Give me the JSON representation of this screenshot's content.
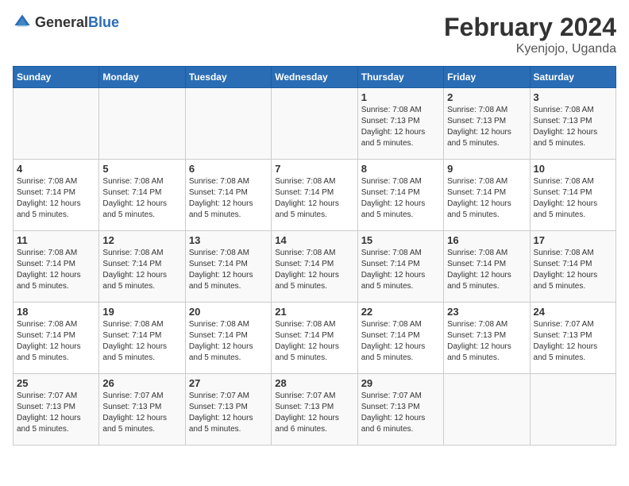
{
  "logo": {
    "general": "General",
    "blue": "Blue"
  },
  "title": "February 2024",
  "location": "Kyenjojo, Uganda",
  "days_of_week": [
    "Sunday",
    "Monday",
    "Tuesday",
    "Wednesday",
    "Thursday",
    "Friday",
    "Saturday"
  ],
  "weeks": [
    [
      {
        "day": "",
        "info": ""
      },
      {
        "day": "",
        "info": ""
      },
      {
        "day": "",
        "info": ""
      },
      {
        "day": "",
        "info": ""
      },
      {
        "day": "1",
        "info": "Sunrise: 7:08 AM\nSunset: 7:13 PM\nDaylight: 12 hours\nand 5 minutes."
      },
      {
        "day": "2",
        "info": "Sunrise: 7:08 AM\nSunset: 7:13 PM\nDaylight: 12 hours\nand 5 minutes."
      },
      {
        "day": "3",
        "info": "Sunrise: 7:08 AM\nSunset: 7:13 PM\nDaylight: 12 hours\nand 5 minutes."
      }
    ],
    [
      {
        "day": "4",
        "info": "Sunrise: 7:08 AM\nSunset: 7:14 PM\nDaylight: 12 hours\nand 5 minutes."
      },
      {
        "day": "5",
        "info": "Sunrise: 7:08 AM\nSunset: 7:14 PM\nDaylight: 12 hours\nand 5 minutes."
      },
      {
        "day": "6",
        "info": "Sunrise: 7:08 AM\nSunset: 7:14 PM\nDaylight: 12 hours\nand 5 minutes."
      },
      {
        "day": "7",
        "info": "Sunrise: 7:08 AM\nSunset: 7:14 PM\nDaylight: 12 hours\nand 5 minutes."
      },
      {
        "day": "8",
        "info": "Sunrise: 7:08 AM\nSunset: 7:14 PM\nDaylight: 12 hours\nand 5 minutes."
      },
      {
        "day": "9",
        "info": "Sunrise: 7:08 AM\nSunset: 7:14 PM\nDaylight: 12 hours\nand 5 minutes."
      },
      {
        "day": "10",
        "info": "Sunrise: 7:08 AM\nSunset: 7:14 PM\nDaylight: 12 hours\nand 5 minutes."
      }
    ],
    [
      {
        "day": "11",
        "info": "Sunrise: 7:08 AM\nSunset: 7:14 PM\nDaylight: 12 hours\nand 5 minutes."
      },
      {
        "day": "12",
        "info": "Sunrise: 7:08 AM\nSunset: 7:14 PM\nDaylight: 12 hours\nand 5 minutes."
      },
      {
        "day": "13",
        "info": "Sunrise: 7:08 AM\nSunset: 7:14 PM\nDaylight: 12 hours\nand 5 minutes."
      },
      {
        "day": "14",
        "info": "Sunrise: 7:08 AM\nSunset: 7:14 PM\nDaylight: 12 hours\nand 5 minutes."
      },
      {
        "day": "15",
        "info": "Sunrise: 7:08 AM\nSunset: 7:14 PM\nDaylight: 12 hours\nand 5 minutes."
      },
      {
        "day": "16",
        "info": "Sunrise: 7:08 AM\nSunset: 7:14 PM\nDaylight: 12 hours\nand 5 minutes."
      },
      {
        "day": "17",
        "info": "Sunrise: 7:08 AM\nSunset: 7:14 PM\nDaylight: 12 hours\nand 5 minutes."
      }
    ],
    [
      {
        "day": "18",
        "info": "Sunrise: 7:08 AM\nSunset: 7:14 PM\nDaylight: 12 hours\nand 5 minutes."
      },
      {
        "day": "19",
        "info": "Sunrise: 7:08 AM\nSunset: 7:14 PM\nDaylight: 12 hours\nand 5 minutes."
      },
      {
        "day": "20",
        "info": "Sunrise: 7:08 AM\nSunset: 7:14 PM\nDaylight: 12 hours\nand 5 minutes."
      },
      {
        "day": "21",
        "info": "Sunrise: 7:08 AM\nSunset: 7:14 PM\nDaylight: 12 hours\nand 5 minutes."
      },
      {
        "day": "22",
        "info": "Sunrise: 7:08 AM\nSunset: 7:14 PM\nDaylight: 12 hours\nand 5 minutes."
      },
      {
        "day": "23",
        "info": "Sunrise: 7:08 AM\nSunset: 7:13 PM\nDaylight: 12 hours\nand 5 minutes."
      },
      {
        "day": "24",
        "info": "Sunrise: 7:07 AM\nSunset: 7:13 PM\nDaylight: 12 hours\nand 5 minutes."
      }
    ],
    [
      {
        "day": "25",
        "info": "Sunrise: 7:07 AM\nSunset: 7:13 PM\nDaylight: 12 hours\nand 5 minutes."
      },
      {
        "day": "26",
        "info": "Sunrise: 7:07 AM\nSunset: 7:13 PM\nDaylight: 12 hours\nand 5 minutes."
      },
      {
        "day": "27",
        "info": "Sunrise: 7:07 AM\nSunset: 7:13 PM\nDaylight: 12 hours\nand 5 minutes."
      },
      {
        "day": "28",
        "info": "Sunrise: 7:07 AM\nSunset: 7:13 PM\nDaylight: 12 hours\nand 6 minutes."
      },
      {
        "day": "29",
        "info": "Sunrise: 7:07 AM\nSunset: 7:13 PM\nDaylight: 12 hours\nand 6 minutes."
      },
      {
        "day": "",
        "info": ""
      },
      {
        "day": "",
        "info": ""
      }
    ]
  ]
}
